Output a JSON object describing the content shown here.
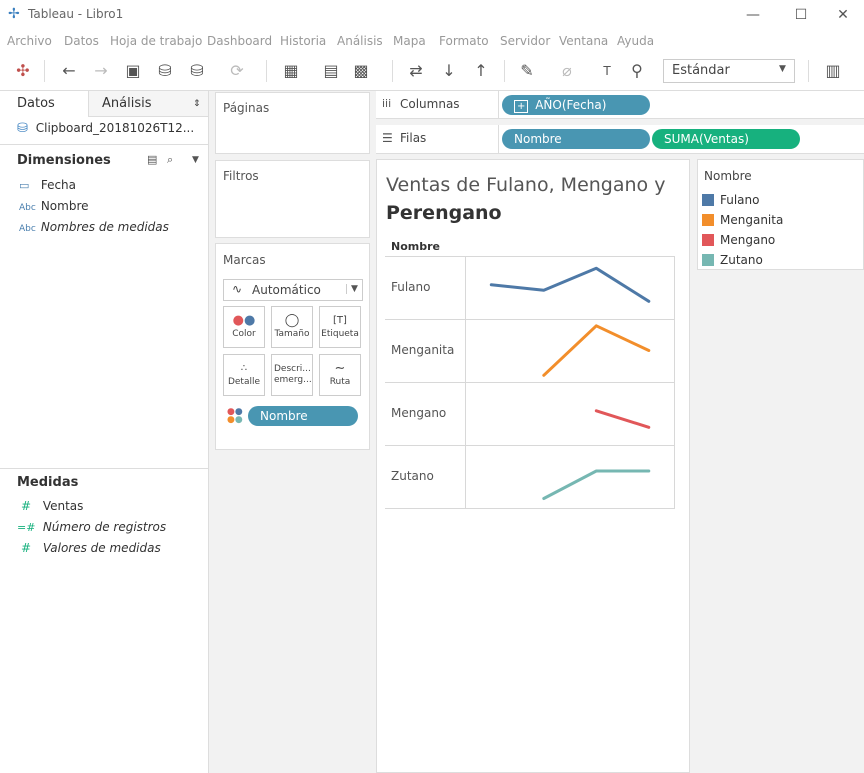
{
  "window": {
    "title": "Tableau - Libro1",
    "minimize": "—",
    "maximize": "☐",
    "close": "✕"
  },
  "menu": [
    "Archivo",
    "Datos",
    "Hoja de trabajo",
    "Dashboard",
    "Historia",
    "Análisis",
    "Mapa",
    "Formato",
    "Servidor",
    "Ventana",
    "Ayuda"
  ],
  "toolbar": {
    "fit_value": "Estándar"
  },
  "left": {
    "tab_data": "Datos",
    "tab_analysis": "Análisis",
    "datasource": "Clipboard_20181026T12...",
    "dimensions_title": "Dimensiones",
    "dimensions": [
      {
        "icon": "calendar-icon",
        "label": "Fecha",
        "italic": false
      },
      {
        "icon": "abc",
        "label": "Nombre",
        "italic": false
      },
      {
        "icon": "abc",
        "label": "Nombres de medidas",
        "italic": true
      }
    ],
    "measures_title": "Medidas",
    "measures": [
      {
        "icon": "#",
        "label": "Ventas",
        "italic": false
      },
      {
        "icon": "=#",
        "label": "Número de registros",
        "italic": true
      },
      {
        "icon": "#",
        "label": "Valores de medidas",
        "italic": true
      }
    ]
  },
  "cards": {
    "pages": "Páginas",
    "filters": "Filtros",
    "marks": "Marcas",
    "mark_type": "Automático",
    "mark_buttons": [
      "Color",
      "Tamaño",
      "Etiqueta",
      "Detalle",
      "Descri... emerg...",
      "Ruta"
    ],
    "mark_pill": "Nombre"
  },
  "shelves": {
    "columns_label": "Columnas",
    "columns_pill": "AÑO(Fecha)",
    "rows_label": "Filas",
    "rows_pills": [
      "Nombre",
      "SUMA(Ventas)"
    ]
  },
  "view": {
    "title_line1": "Ventas de Fulano, Mengano y",
    "title_line2": "Perengano",
    "row_header": "Nombre"
  },
  "legend": {
    "title": "Nombre",
    "items": [
      {
        "name": "Fulano",
        "color": "#4e79a7"
      },
      {
        "name": "Menganita",
        "color": "#f28e2b"
      },
      {
        "name": "Mengano",
        "color": "#e15759"
      },
      {
        "name": "Zutano",
        "color": "#76b7b2"
      }
    ]
  },
  "chart_data": {
    "type": "line",
    "series": [
      {
        "name": "Fulano",
        "color": "#4e79a7",
        "values": [
          0.55,
          0.45,
          0.85,
          0.25
        ]
      },
      {
        "name": "Menganita",
        "color": "#f28e2b",
        "values": [
          null,
          0.05,
          0.95,
          0.5
        ]
      },
      {
        "name": "Mengano",
        "color": "#e15759",
        "values": [
          null,
          null,
          0.55,
          0.25
        ]
      },
      {
        "name": "Zutano",
        "color": "#76b7b2",
        "values": [
          null,
          0.1,
          0.6,
          0.6
        ]
      }
    ]
  }
}
